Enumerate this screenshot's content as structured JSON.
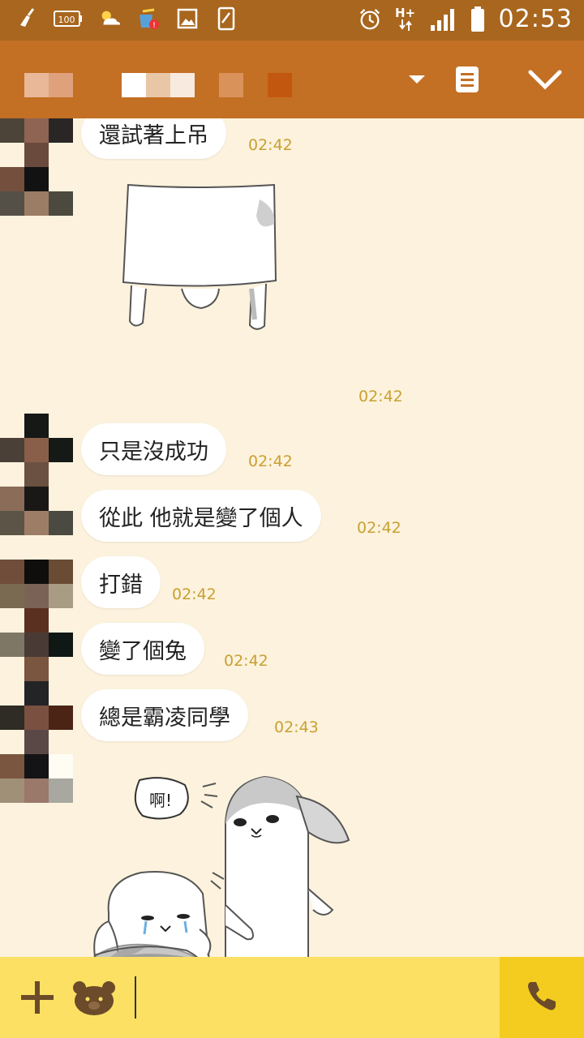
{
  "status_bar": {
    "time": "02:53",
    "battery_text": "100",
    "network": "H+",
    "left_icons": [
      "broom-icon",
      "battery-100-icon",
      "weather-icon",
      "store-alert-icon",
      "image-icon",
      "screenshot-icon"
    ],
    "right_icons": [
      "alarm-icon",
      "network-icon",
      "signal-icon",
      "battery-icon"
    ]
  },
  "header": {
    "icons": [
      "dropdown-arrow-icon",
      "notes-icon",
      "chevron-down-icon"
    ]
  },
  "messages": [
    {
      "text": "還試著上吊",
      "time": "02:42"
    },
    {
      "sticker": "hanging-cat-sticker",
      "time": "02:42"
    },
    {
      "text": "只是沒成功",
      "time": "02:42"
    },
    {
      "text": "從此 他就是變了個人",
      "time": "02:42"
    },
    {
      "text": "打錯",
      "time": "02:42"
    },
    {
      "text": "變了個兔",
      "time": "02:42"
    },
    {
      "text": "總是霸凌同學",
      "time": "02:43"
    },
    {
      "sticker": "rabbits-sticker",
      "sticker_text": "啊!"
    }
  ],
  "bottom_bar": {
    "icons": [
      "plus-icon",
      "bear-sticker-icon",
      "phone-icon"
    ],
    "input_value": ""
  },
  "colors": {
    "status_bar": "#a8661e",
    "header": "#c36f24",
    "chat_bg": "#fcf2dd",
    "bottom_bar": "#fbe063",
    "call_button": "#f4cc1f",
    "timestamp": "#c9a032"
  }
}
